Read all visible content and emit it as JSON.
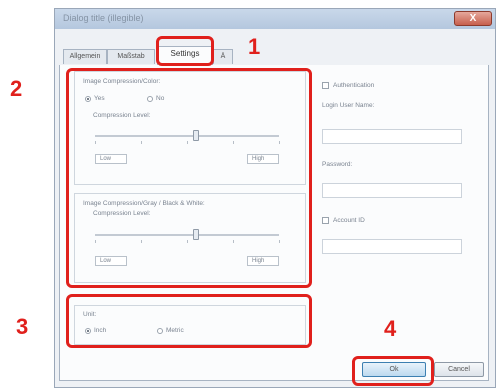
{
  "dialog": {
    "title": "Dialog title (illegible)",
    "close_label": "X"
  },
  "tabs": [
    {
      "label": "Allgemein"
    },
    {
      "label": "Maßstab"
    },
    {
      "label": "Settings"
    },
    {
      "label": "Ä"
    }
  ],
  "image_compression_color": {
    "heading": "Image Compression/Color:",
    "options": [
      "Yes",
      "No"
    ],
    "selected": "Yes",
    "level_label": "Compression Level:",
    "level_value": 0.55,
    "min_label": "Low",
    "max_label": "High"
  },
  "image_compression_gray": {
    "heading": "Image Compression/Gray / Black & White:",
    "level_label": "Compression Level:",
    "level_value": 0.55,
    "min_label": "Low",
    "max_label": "High"
  },
  "unit": {
    "heading": "Unit:",
    "options": [
      "Inch",
      "Metric"
    ],
    "selected": "Inch"
  },
  "authentication": {
    "checkbox_label": "Authentication",
    "login_user_name_label": "Login User Name:",
    "login_user_name_value": "",
    "password_label": "Password:",
    "password_value": "",
    "account_id_label": "Account ID",
    "account_id_value": ""
  },
  "buttons": {
    "ok": "Ok",
    "cancel": "Cancel"
  },
  "callouts": {
    "one": "1",
    "two": "2",
    "three": "3",
    "four": "4"
  },
  "colors": {
    "highlight": "#e0201c"
  }
}
